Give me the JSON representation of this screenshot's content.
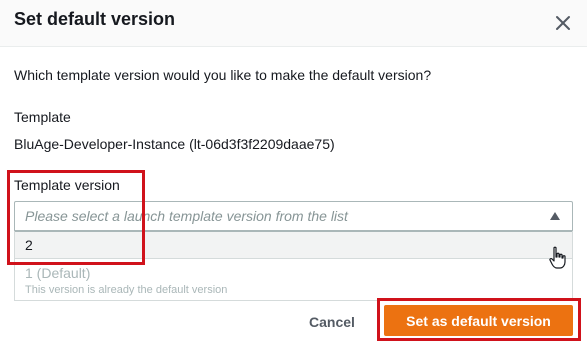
{
  "dialog": {
    "title": "Set default version",
    "close_icon": "close-icon",
    "question": "Which template version would you like to make the default version?"
  },
  "template": {
    "label": "Template",
    "value": "BluAge-Developer-Instance (lt-06d3f3f2209daae75)"
  },
  "template_version": {
    "label": "Template version",
    "placeholder": "Please select a launch template version from the list",
    "caret_icon": "caret-up-icon",
    "options": [
      {
        "label": "2",
        "description": "",
        "state": "highlighted"
      },
      {
        "label": "1 (Default)",
        "description": "This version is already the default version",
        "state": "disabled"
      }
    ]
  },
  "footer": {
    "cancel_label": "Cancel",
    "primary_label": "Set as default version"
  },
  "colors": {
    "primary": "#ec7211",
    "highlight_annotation": "#d0121b",
    "text": "#16191f",
    "muted": "#aab7b8"
  }
}
